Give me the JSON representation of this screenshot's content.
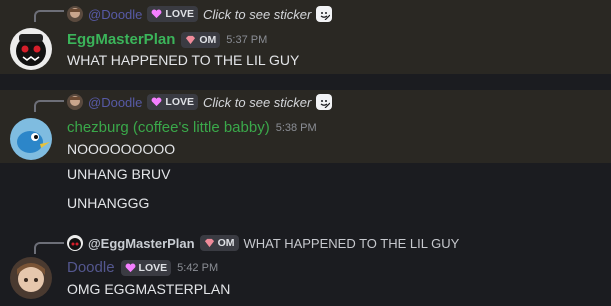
{
  "colors": {
    "background": "#1b1c20",
    "highlight": "#2a2823",
    "eggmasterplan_name": "#3bb45a",
    "chezburg_name": "#3aa84a",
    "doodle_name": "#54578f",
    "tag_background": "#3a3b42"
  },
  "messages": [
    {
      "reply": {
        "author": "@Doodle",
        "tag": "LOVE",
        "text": "Click to see sticker",
        "icon": "sticker-icon"
      },
      "author": "EggMasterPlan",
      "tag": "OM",
      "time": "5:37 PM",
      "lines": [
        "WHAT HAPPENED TO THE LIL GUY"
      ]
    },
    {
      "reply": {
        "author": "@Doodle",
        "tag": "LOVE",
        "text": "Click to see sticker",
        "icon": "sticker-icon"
      },
      "author": "chezburg (coffee's little babby)",
      "time": "5:38 PM",
      "lines": [
        "NOOOOOOOOO",
        "UNHANG BRUV",
        "UNHANGGG"
      ]
    },
    {
      "reply": {
        "author": "@EggMasterPlan",
        "tag": "OM",
        "text": "WHAT HAPPENED TO THE LIL GUY"
      },
      "author": "Doodle",
      "tag": "LOVE",
      "time": "5:42 PM",
      "lines": [
        "OMG EGGMASTERPLAN"
      ]
    }
  ]
}
